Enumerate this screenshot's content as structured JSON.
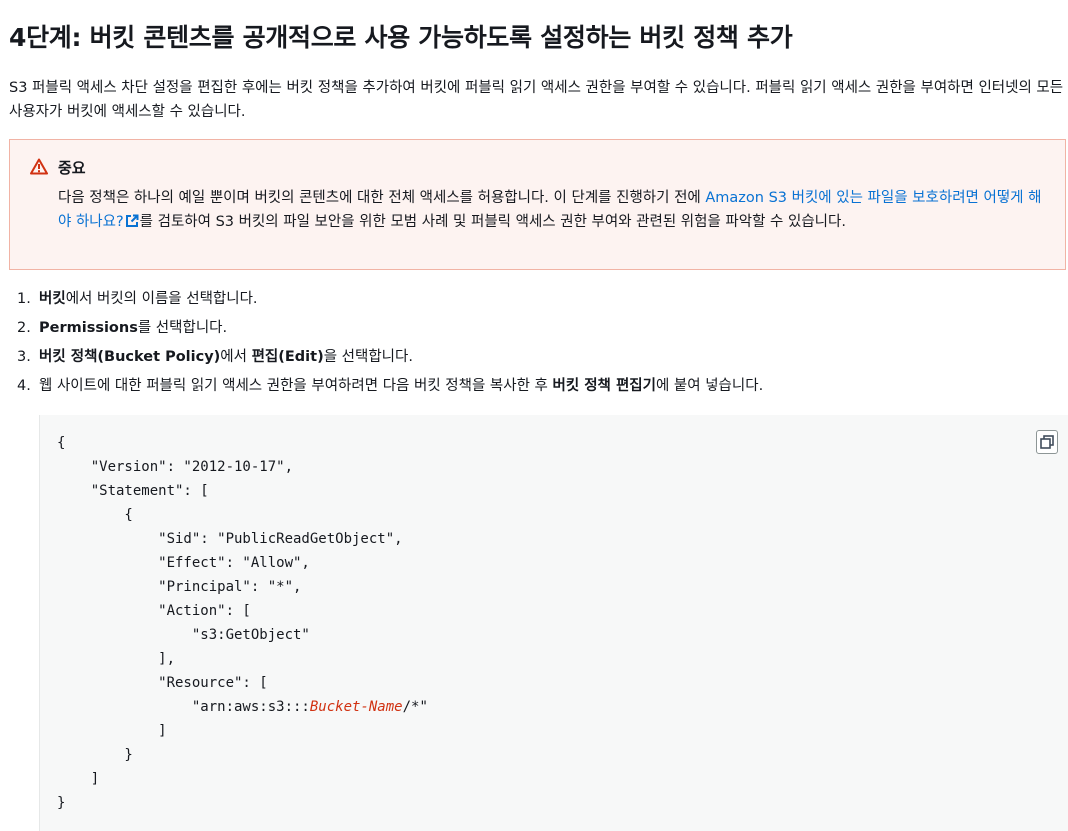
{
  "heading": "4단계: 버킷 콘텐츠를 공개적으로 사용 가능하도록 설정하는 버킷 정책 추가",
  "intro": "S3 퍼블릭 액세스 차단 설정을 편집한 후에는 버킷 정책을 추가하여 버킷에 퍼블릭 읽기 액세스 권한을 부여할 수 있습니다. 퍼블릭 읽기 액세스 권한을 부여하면 인터넷의 모든 사용자가 버킷에 액세스할 수 있습니다.",
  "alert": {
    "title": "중요",
    "text_before_link": "다음 정책은 하나의 예일 뿐이며 버킷의 콘텐츠에 대한 전체 액세스를 허용합니다. 이 단계를 진행하기 전에 ",
    "link_text": "Amazon S3 버킷에 있는 파일을 보호하려면 어떻게 해야 하나요?",
    "text_after_link": "를 검토하여 S3 버킷의 파일 보안을 위한 모범 사례 및 퍼블릭 액세스 권한 부여와 관련된 위험을 파악할 수 있습니다.",
    "icon": "warning-icon",
    "link_icon": "external-link-icon"
  },
  "steps": [
    {
      "num": "1.",
      "bold1": "버킷",
      "text1": "에서 버킷의 이름을 선택합니다."
    },
    {
      "num": "2.",
      "bold1": "Permissions",
      "text1": "를 선택합니다."
    },
    {
      "num": "3.",
      "bold1": "버킷 정책(Bucket Policy)",
      "text1": "에서 ",
      "bold2": "편집(Edit)",
      "text2": "을 선택합니다."
    },
    {
      "num": "4.",
      "text0": "웹 사이트에 대한 퍼블릭 읽기 액세스 권한을 부여하려면 다음 버킷 정책을 복사한 후 ",
      "bold1": "버킷 정책 편집기",
      "text1": "에 붙여 넣습니다."
    }
  ],
  "code": {
    "lines": [
      "{",
      "    \"Version\": \"2012-10-17\",",
      "    \"Statement\": [",
      "        {",
      "            \"Sid\": \"PublicReadGetObject\",",
      "            \"Effect\": \"Allow\",",
      "            \"Principal\": \"*\",",
      "            \"Action\": [",
      "                \"s3:GetObject\"",
      "            ],",
      "            \"Resource\": [",
      "                \"arn:aws:s3:::",
      "            ]",
      "        }",
      "    ]",
      "}"
    ],
    "placeholder": "Bucket-Name",
    "resource_suffix": "/*\"",
    "copy_icon": "copy-icon"
  },
  "colors": {
    "link": "#0972d3",
    "alert_bg": "#fdf3f1",
    "alert_border": "#f1b3a5",
    "warning": "#d13212",
    "code_bg": "#f7f8f8"
  }
}
